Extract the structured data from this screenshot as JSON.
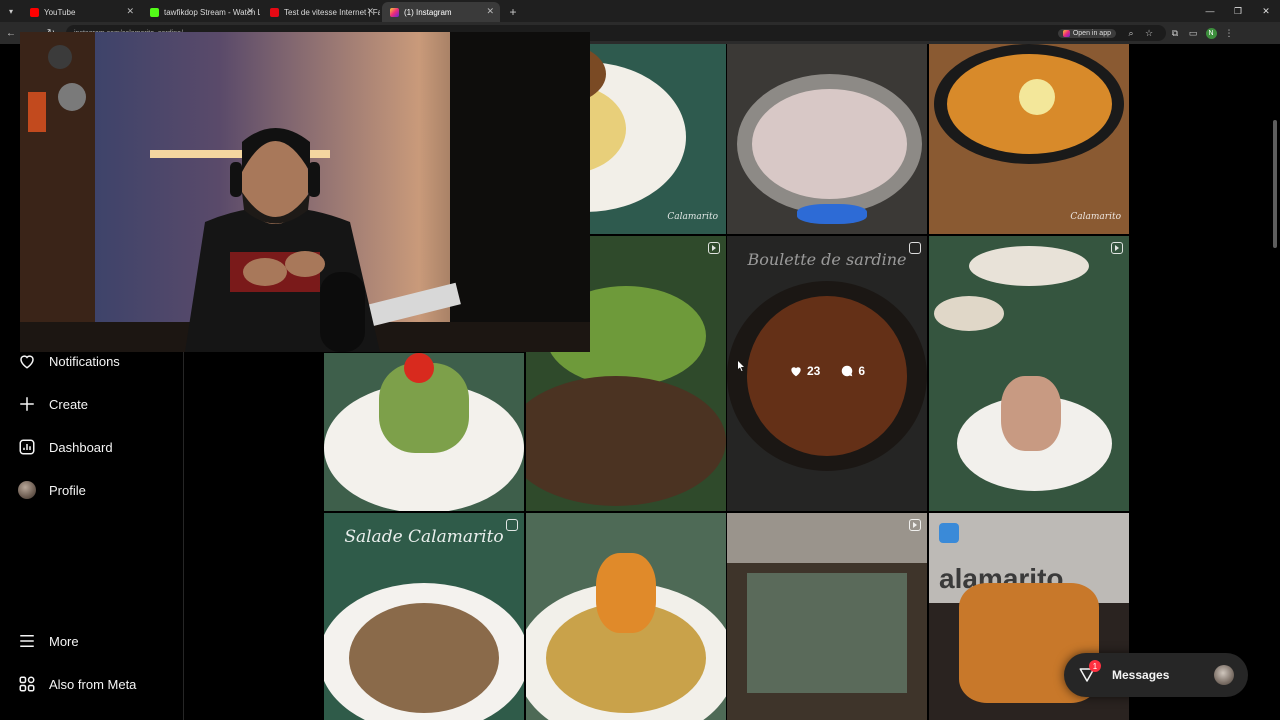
{
  "browser": {
    "tabs": [
      {
        "title": "YouTube",
        "color": "#ff0000",
        "active": false
      },
      {
        "title": "tawfikdop Stream - Watch Live",
        "color": "#53fc18",
        "active": false
      },
      {
        "title": "Test de vitesse Internet | Fast.com",
        "color": "#e50914",
        "active": false
      },
      {
        "title": "(1) Instagram",
        "color": "#d62976",
        "active": true
      }
    ],
    "url": "instagram.com/calamarito_sardine/",
    "open_in_app": "Open in app",
    "profile_initial": "N"
  },
  "sidebar": {
    "items": [
      {
        "label": "Notifications",
        "icon": "heart-icon"
      },
      {
        "label": "Create",
        "icon": "plus-icon"
      },
      {
        "label": "Dashboard",
        "icon": "dashboard-icon"
      },
      {
        "label": "Profile",
        "icon": "avatar"
      },
      {
        "label": "More",
        "icon": "menu-icon"
      },
      {
        "label": "Also from Meta",
        "icon": "meta-apps-icon"
      }
    ]
  },
  "posts": {
    "brand_watermark": "Calamarito",
    "hovered": {
      "likes": "23",
      "comments": "6",
      "caption": "Boulette de sardine"
    },
    "salad_caption": "Salade Calamarito",
    "restaurant_sign": "alamarito"
  },
  "messages": {
    "label": "Messages",
    "unread": "1"
  }
}
